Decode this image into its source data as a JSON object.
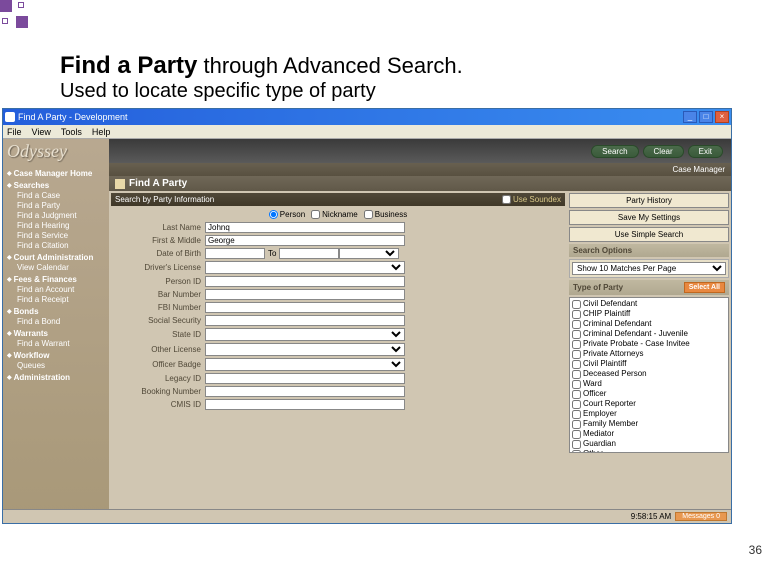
{
  "slide": {
    "title_bold": "Find a Party",
    "title_rest": " through Advanced Search.",
    "subtitle": "Used to locate specific type of party",
    "page_num": "36"
  },
  "window": {
    "title": "Find A Party - Development",
    "menus": [
      "File",
      "View",
      "Tools",
      "Help"
    ],
    "winbtns": {
      "min": "_",
      "max": "□",
      "close": "×"
    }
  },
  "logo": "Odyssey",
  "nav": {
    "home": "Case Manager Home",
    "groups": [
      {
        "head": "Searches",
        "items": [
          "Find a Case",
          "Find a Party",
          "Find a Judgment",
          "Find a Hearing",
          "Find a Service",
          "Find a Citation"
        ]
      },
      {
        "head": "Court Administration",
        "items": [
          "View Calendar"
        ]
      },
      {
        "head": "Fees & Finances",
        "items": [
          "Find an Account",
          "Find a Receipt"
        ]
      },
      {
        "head": "Bonds",
        "items": [
          "Find a Bond"
        ]
      },
      {
        "head": "Warrants",
        "items": [
          "Find a Warrant"
        ]
      },
      {
        "head": "Workflow",
        "items": [
          "Queues"
        ]
      },
      {
        "head": "Administration",
        "items": []
      }
    ]
  },
  "toolbar": {
    "search": "Search",
    "clear": "Clear",
    "exit": "Exit"
  },
  "breadcrumb": {
    "right": "Case Manager"
  },
  "page_header": "Find A Party",
  "section": {
    "title": "Search by Party Information",
    "soundex": "Use Soundex"
  },
  "radios": {
    "person": "Person",
    "nickname": "Nickname",
    "business": "Business"
  },
  "fields": {
    "lastname": {
      "label": "Last Name",
      "value": "Johnq"
    },
    "first_mid": {
      "label": "First & Middle",
      "value": "George"
    },
    "dob": {
      "label": "Date of Birth",
      "sep": "To"
    },
    "drivers": {
      "label": "Driver's License"
    },
    "personid": {
      "label": "Person ID"
    },
    "barnum": {
      "label": "Bar Number"
    },
    "fbi": {
      "label": "FBI Number"
    },
    "ssn": {
      "label": "Social Security"
    },
    "stateid": {
      "label": "State ID"
    },
    "other_lic": {
      "label": "Other License"
    },
    "other_badge": {
      "label": "Officer Badge"
    },
    "legacy": {
      "label": "Legacy ID"
    },
    "booking": {
      "label": "Booking Number"
    },
    "cmis": {
      "label": "CMIS ID"
    }
  },
  "right": {
    "history": "Party History",
    "save": "Save My Settings",
    "simple": "Use Simple Search",
    "options_hdr": "Search Options",
    "options_val": "Show 10 Matches Per Page",
    "type_hdr": "Type of Party",
    "select_all": "Select All",
    "types": [
      "Civil Defendant",
      "CHIP Plaintiff",
      "Criminal Defendant",
      "Criminal Defendant - Juvenile",
      "Private Probate - Case Invitee",
      "Private Attorneys",
      "Civil Plaintiff",
      "Deceased Person",
      "Ward",
      "Officer",
      "Court Reporter",
      "Employer",
      "Family Member",
      "Mediator",
      "Guardian",
      "Other"
    ]
  },
  "status": {
    "time": "9:58:15 AM",
    "msgs": "Messages",
    "count": "0"
  }
}
